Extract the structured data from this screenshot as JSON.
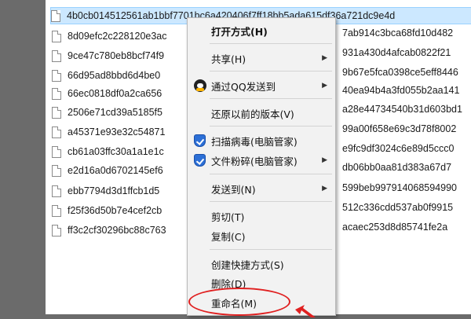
{
  "files": [
    {
      "left": "4b0cb014512561ab1bbf7701bc6a420406f7ff18bb5ada615df36a721dc9e4d",
      "right": "",
      "selected": true
    },
    {
      "left": "8d09efc2c228120e3ac",
      "right": "7ab914c3bca68fd10d482"
    },
    {
      "left": "9ce47c780eb8bcf74f9",
      "right": "931a430d4afcab0822f21"
    },
    {
      "left": "66d95ad8bbd6d4be0",
      "right": "9b67e5fca0398ce5eff8446"
    },
    {
      "left": "66ec0818df0a2ca656",
      "right": "40ea94b4a3fd055b2aa141"
    },
    {
      "left": "2506e71cd39a5185f5",
      "right": "a28e44734540b31d603bd1"
    },
    {
      "left": "a45371e93e32c54871",
      "right": "99a00f658e69c3d78f8002"
    },
    {
      "left": "cb61a03ffc30a1a1e1c",
      "right": "e9fc9df3024c6e89d5ccc0"
    },
    {
      "left": "e2d16a0d6702145ef6",
      "right": "db06bb0aa81d383a67d7"
    },
    {
      "left": "ebb7794d3d1ffcb1d5",
      "right": "599beb997914068594990"
    },
    {
      "left": "f25f36d50b7e4cef2cb",
      "right": "512c336cdd537ab0f9915"
    },
    {
      "left": "ff3c2cf30296bc88c763",
      "right": "acaec253d8d85741fe2a"
    }
  ],
  "menu": {
    "open_with": "打开方式(H)",
    "share": "共享(H)",
    "send_qq": "通过QQ发送到",
    "restore": "还原以前的版本(V)",
    "scan_virus": "扫描病毒(电脑管家)",
    "shred": "文件粉碎(电脑管家)",
    "send_to": "发送到(N)",
    "cut": "剪切(T)",
    "copy": "复制(C)",
    "create_shortcut": "创建快捷方式(S)",
    "delete": "删除(D)",
    "rename": "重命名(M)",
    "submenu_arrow": "▶"
  },
  "colors": {
    "selection": "#cce8ff",
    "highlight_ring": "#e02020",
    "shield": "#2c6fd6"
  },
  "icons": [
    "file-icon",
    "qq-icon",
    "shield-icon",
    "chevron-right-icon",
    "red-arrow-icon"
  ]
}
